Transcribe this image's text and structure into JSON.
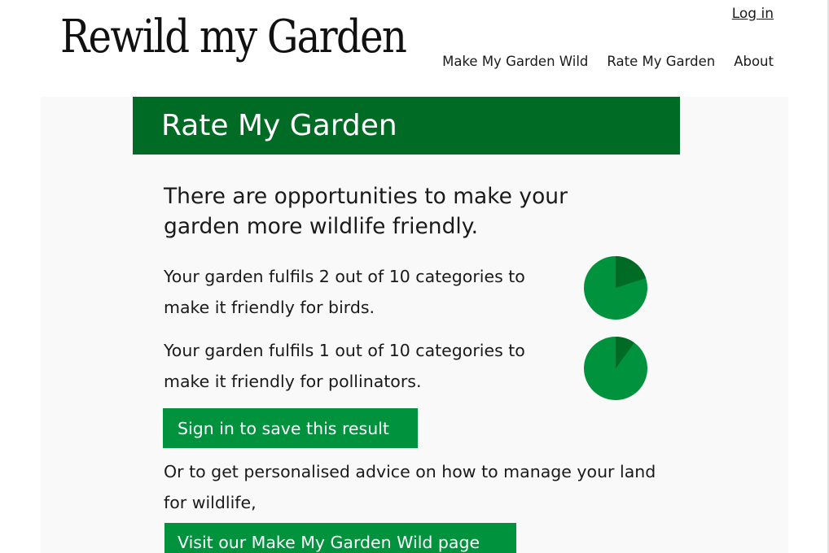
{
  "header": {
    "logo_text": "Rewild my Garden",
    "login_label": "Log in",
    "nav": [
      {
        "label": "Make My Garden Wild"
      },
      {
        "label": "Rate My Garden"
      },
      {
        "label": "About"
      }
    ]
  },
  "main": {
    "banner_title": "Rate My Garden",
    "headline": "There are opportunities to make your garden more wildlife friendly.",
    "results": [
      {
        "text": "Your garden fulfils 2 out of 10 categories to make it friendly for birds.",
        "fulfilled": 2,
        "total": 10
      },
      {
        "text": "Your garden fulfils 1 out of 10 categories to make it friendly for pollinators.",
        "fulfilled": 1,
        "total": 10
      }
    ],
    "signin_button": "Sign in to save this result",
    "advice_text": "Or to get personalised advice on how to manage your land for wildlife,",
    "visit_button": "Visit our Make My Garden Wild page"
  },
  "colors": {
    "banner": "#006b25",
    "button": "#00923c",
    "pie_base": "#00923c",
    "pie_slice": "#006b25",
    "panel_bg": "#f9f9f9"
  },
  "icons": [
    "birds-score-pie",
    "pollinators-score-pie"
  ]
}
